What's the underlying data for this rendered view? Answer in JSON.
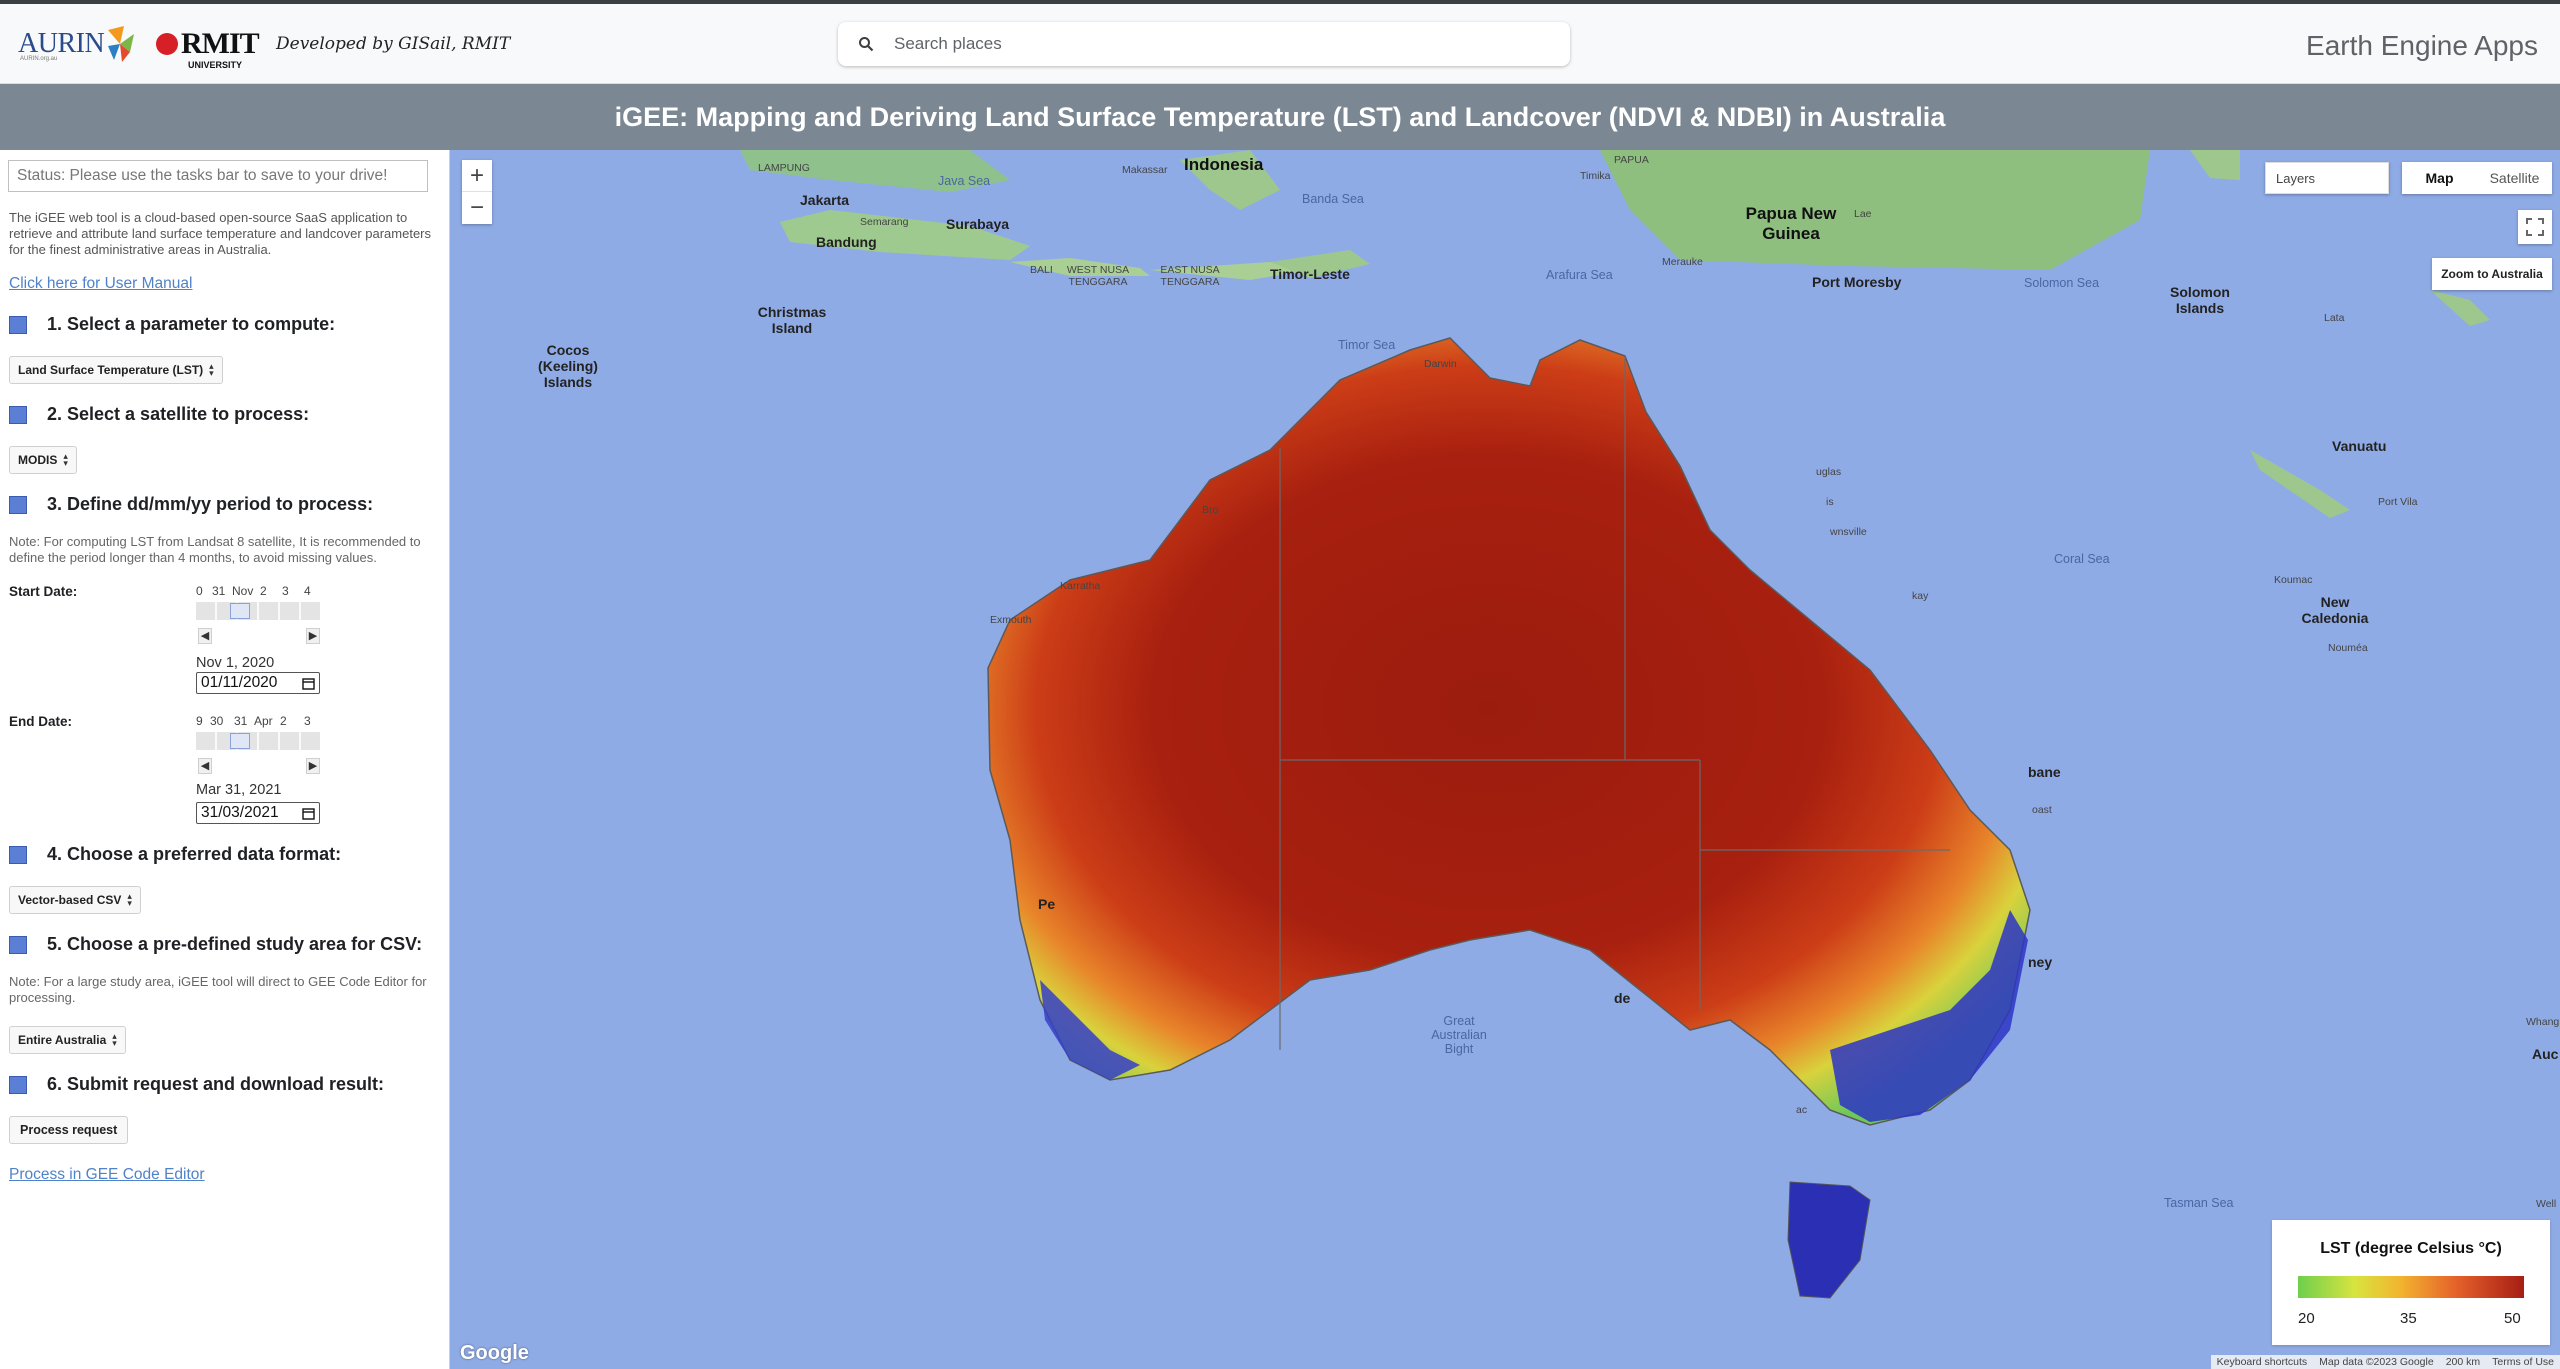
{
  "header": {
    "aurin_logo": "AURIN",
    "aurin_sub": "AURIN.org.au",
    "rmit_logo": "RMIT",
    "rmit_sub": "UNIVERSITY",
    "developed_by": "Developed by GISail, RMIT",
    "search_placeholder": "Search places",
    "app_name": "Earth Engine Apps"
  },
  "title": "iGEE: Mapping and Deriving Land Surface Temperature (LST) and Landcover (NDVI & NDBI) in Australia",
  "sidebar": {
    "status": "Status: Please use the tasks bar to save to your drive!",
    "intro": "The iGEE web tool is a cloud-based open-source SaaS application to retrieve and attribute land surface temperature and landcover parameters for the finest administrative areas in Australia.",
    "manual_link": "Click here for User Manual",
    "step1": "1. Select a parameter to compute:",
    "parameter_value": "Land Surface Temperature (LST)",
    "step2": "2. Select a satellite to process:",
    "satellite_value": "MODIS",
    "step3": "3. Define dd/mm/yy period to process:",
    "note_period": "Note: For computing LST from Landsat 8 satellite, It is recommended to define the period longer than 4 months, to avoid missing values.",
    "start_label": "Start Date:",
    "start_ticks": [
      "0",
      "31",
      "Nov",
      "2",
      "3",
      "4"
    ],
    "start_text": "Nov 1, 2020",
    "start_input": "01/11/2020",
    "end_label": "End Date:",
    "end_ticks": [
      "9",
      "30",
      "31",
      "Apr",
      "2",
      "3"
    ],
    "end_text": "Mar 31, 2021",
    "end_input": "31/03/2021",
    "step4": "4. Choose a preferred data format:",
    "format_value": "Vector-based CSV",
    "step5": "5. Choose a pre-defined study area for CSV:",
    "note_area": "Note: For a large study area, iGEE tool will direct to GEE Code Editor for processing.",
    "area_value": "Entire Australia",
    "step6": "6. Submit request and download result:",
    "process_button": "Process request",
    "gee_link": "Process in GEE Code Editor"
  },
  "map": {
    "zoom_in": "+",
    "zoom_out": "−",
    "layers": "Layers",
    "map_type": [
      "Map",
      "Satellite"
    ],
    "zoom_to": "Zoom to Australia",
    "labels": {
      "indonesia": "Indonesia",
      "jakarta": "Jakarta",
      "bandung": "Bandung",
      "semarang": "Semarang",
      "surabaya": "Surabaya",
      "lampung": "LAMPUNG",
      "makassar": "Makassar",
      "java_sea": "Java Sea",
      "banda_sea": "Banda Sea",
      "papua": "PAPUA",
      "timika": "Timika",
      "png": "Papua New Guinea",
      "lae": "Lae",
      "merauke": "Merauke",
      "port_moresby": "Port Moresby",
      "solomon_sea": "Solomon Sea",
      "solomon_islands": "Solomon Islands",
      "lata": "Lata",
      "christmas": "Christmas Island",
      "cocos": "Cocos (Keeling) Islands",
      "bali": "BALI",
      "ntb": "WEST NUSA TENGGARA",
      "ntt": "EAST NUSA TENGGARA",
      "timor_leste": "Timor-Leste",
      "arafura_sea": "Arafura Sea",
      "timor_sea": "Timor Sea",
      "darwin": "Darwin",
      "coral_sea": "Coral Sea",
      "vanuatu": "Vanuatu",
      "port_vila": "Port Vila",
      "koumac": "Koumac",
      "new_caledonia": "New Caledonia",
      "noumea": "Nouméa",
      "exmouth": "Exmouth",
      "karratha": "Karratha",
      "great_bight": "Great Australian Bight",
      "tasman_sea": "Tasman Sea",
      "broome": "Bro",
      "douglas": "uglas",
      "townsville": "wnsville",
      "mackay": "kay",
      "brisbane": "bane",
      "gold_coast": "oast",
      "sydney": "ney",
      "perth": "Pe",
      "adelaide": "de",
      "melbourne": "ac",
      "is": "is",
      "whang": "Whang",
      "auc": "Auc",
      "well": "Well"
    }
  },
  "legend": {
    "title": "LST (degree Celsius °C)",
    "min": "20",
    "mid": "35",
    "max": "50",
    "colors": [
      "#6ecf4d",
      "#d7e43f",
      "#f2b52f",
      "#e5612a",
      "#a61e14"
    ]
  },
  "attribution": {
    "google": "Google",
    "shortcuts": "Keyboard shortcuts",
    "data": "Map data ©2023 Google",
    "scale": "200 km",
    "terms": "Terms of Use"
  }
}
